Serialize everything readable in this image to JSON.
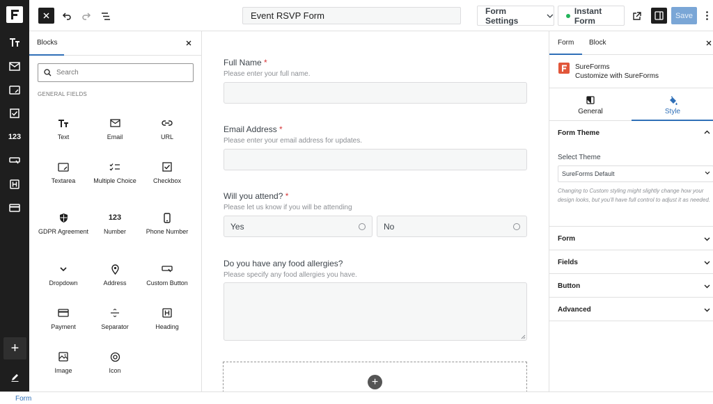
{
  "topbar": {
    "form_title": "Event RSVP Form",
    "form_settings_label": "Form Settings",
    "instant_form_label": "Instant Form",
    "save_label": "Save"
  },
  "blocks_panel": {
    "tab_label": "Blocks",
    "search_placeholder": "Search",
    "section_title": "GENERAL FIELDS",
    "items": [
      {
        "label": "Text",
        "icon": "text-icon"
      },
      {
        "label": "Email",
        "icon": "email-icon"
      },
      {
        "label": "URL",
        "icon": "link-icon"
      },
      {
        "label": "Textarea",
        "icon": "textarea-icon"
      },
      {
        "label": "Multiple Choice",
        "icon": "multiple-choice-icon"
      },
      {
        "label": "Checkbox",
        "icon": "checkbox-icon"
      },
      {
        "label": "GDPR Agreement",
        "icon": "shield-icon"
      },
      {
        "label": "Number",
        "icon": "number-icon"
      },
      {
        "label": "Phone Number",
        "icon": "phone-icon"
      },
      {
        "label": "Dropdown",
        "icon": "chevron-down-icon"
      },
      {
        "label": "Address",
        "icon": "location-pin-icon"
      },
      {
        "label": "Custom Button",
        "icon": "custom-button-icon"
      },
      {
        "label": "Payment",
        "icon": "card-icon"
      },
      {
        "label": "Separator",
        "icon": "separator-icon"
      },
      {
        "label": "Heading",
        "icon": "heading-icon"
      },
      {
        "label": "Image",
        "icon": "image-icon"
      },
      {
        "label": "Icon",
        "icon": "icon-block-icon"
      }
    ],
    "number_glyph": "123"
  },
  "rail": {
    "number_glyph": "123"
  },
  "form": {
    "fields": [
      {
        "label": "Full Name",
        "required_mark": "*",
        "help": "Please enter your full name."
      },
      {
        "label": "Email Address",
        "required_mark": "*",
        "help": "Please enter your email address for updates."
      },
      {
        "label": "Will you attend?",
        "required_mark": "*",
        "help": "Please let us know if you will be attending",
        "options": [
          "Yes",
          "No"
        ]
      },
      {
        "label": "Do you have any food allergies?",
        "help": "Please specify any food allergies you have."
      }
    ]
  },
  "settings": {
    "tabs": [
      "Form",
      "Block"
    ],
    "brand_name": "SureForms",
    "brand_sub": "Customize with SureForms",
    "segments": [
      "General",
      "Style"
    ],
    "active_segment": "Style",
    "form_theme_title": "Form Theme",
    "select_theme_label": "Select Theme",
    "select_theme_value": "SureForms Default",
    "theme_note": "Changing to Custom styling might slightly change how your design looks, but you'll have full control to adjust it as needed.",
    "sections": [
      "Form",
      "Fields",
      "Button",
      "Advanced"
    ]
  },
  "footer": {
    "breadcrumb": "Form"
  },
  "colors": {
    "accent": "#2f6fb7",
    "required": "#d63638",
    "brand": "#e1563a",
    "live_dot": "#22b45a",
    "save_disabled": "#7aa6d6"
  }
}
